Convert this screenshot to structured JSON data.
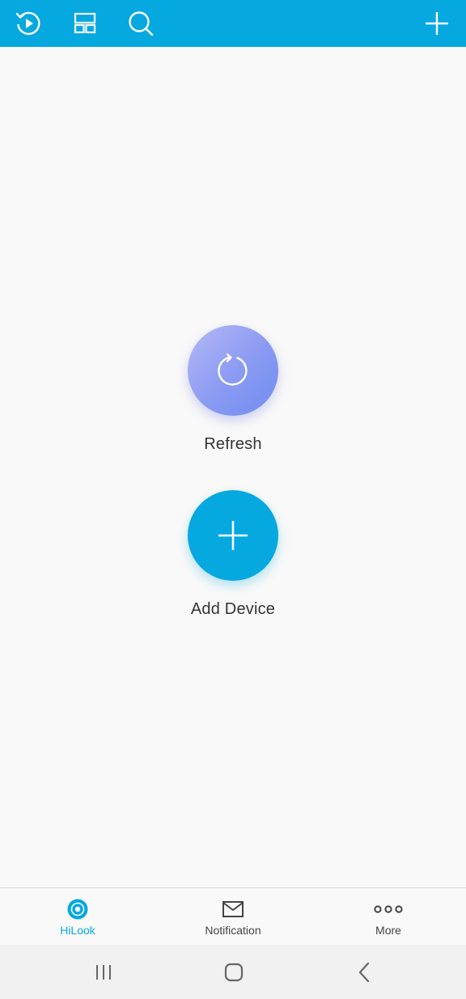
{
  "toolbar": {
    "icons": [
      "playback-icon",
      "layout-icon",
      "search-icon",
      "add-icon"
    ],
    "background_color": "#06a8e0"
  },
  "main": {
    "refresh_label": "Refresh",
    "refresh_icon": "refresh-icon",
    "add_device_label": "Add Device",
    "add_device_icon": "plus-icon"
  },
  "bottom_nav": {
    "items": [
      {
        "label": "HiLook",
        "icon": "hilook-icon",
        "active": true
      },
      {
        "label": "Notification",
        "icon": "envelope-icon",
        "active": false
      },
      {
        "label": "More",
        "icon": "more-dots-icon",
        "active": false
      }
    ],
    "active_color": "#06a8e0"
  },
  "system_nav": {
    "buttons": [
      "recent-apps-icon",
      "home-icon",
      "back-icon"
    ]
  }
}
